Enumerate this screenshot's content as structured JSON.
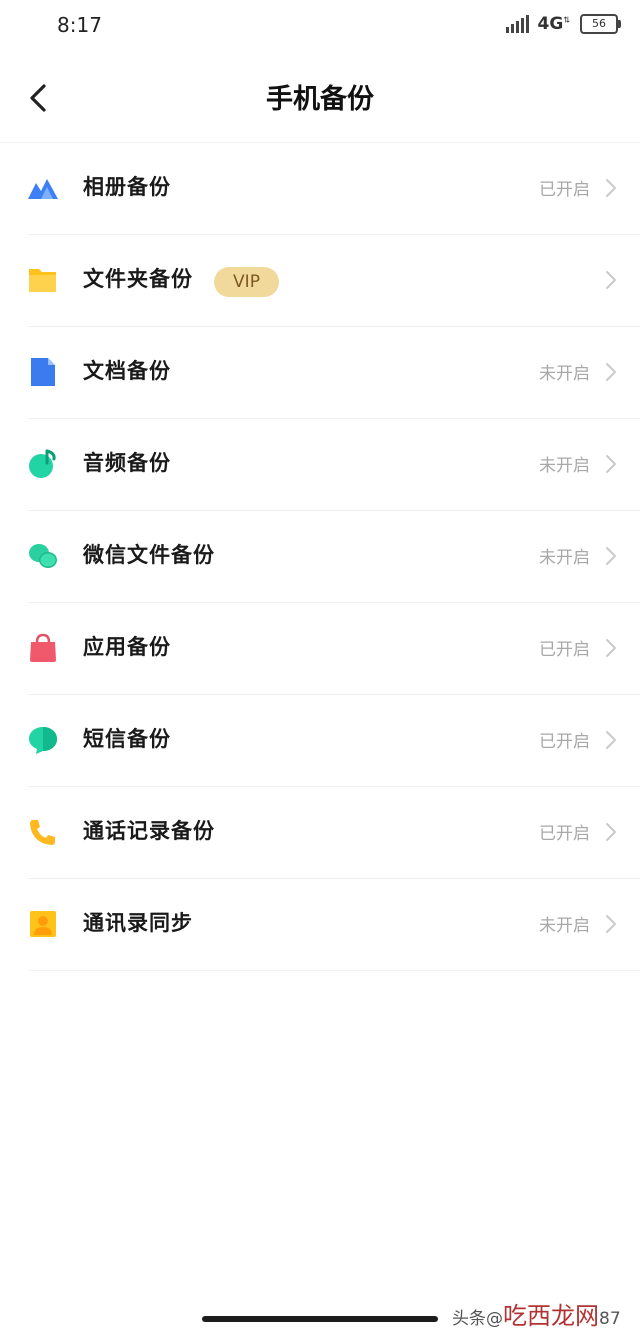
{
  "status_bar": {
    "time": "8:17",
    "network": "4G",
    "battery": "56"
  },
  "header": {
    "title": "手机备份"
  },
  "colors": {
    "accent_vip": "#f0d99a",
    "status_text": "#a8a8a8"
  },
  "items": [
    {
      "label": "相册备份",
      "status": "已开启",
      "icon": "photo-album-icon"
    },
    {
      "label": "文件夹备份",
      "status": "",
      "badge": "VIP",
      "icon": "folder-icon"
    },
    {
      "label": "文档备份",
      "status": "未开启",
      "icon": "document-icon"
    },
    {
      "label": "音频备份",
      "status": "未开启",
      "icon": "music-icon"
    },
    {
      "label": "微信文件备份",
      "status": "未开启",
      "icon": "wechat-icon"
    },
    {
      "label": "应用备份",
      "status": "已开启",
      "icon": "app-bag-icon"
    },
    {
      "label": "短信备份",
      "status": "已开启",
      "icon": "message-icon"
    },
    {
      "label": "通话记录备份",
      "status": "已开启",
      "icon": "phone-icon"
    },
    {
      "label": "通讯录同步",
      "status": "未开启",
      "icon": "contacts-icon"
    }
  ],
  "watermark": {
    "prefix": "头条@",
    "suffix": "87",
    "brand": "吃西龙网"
  }
}
